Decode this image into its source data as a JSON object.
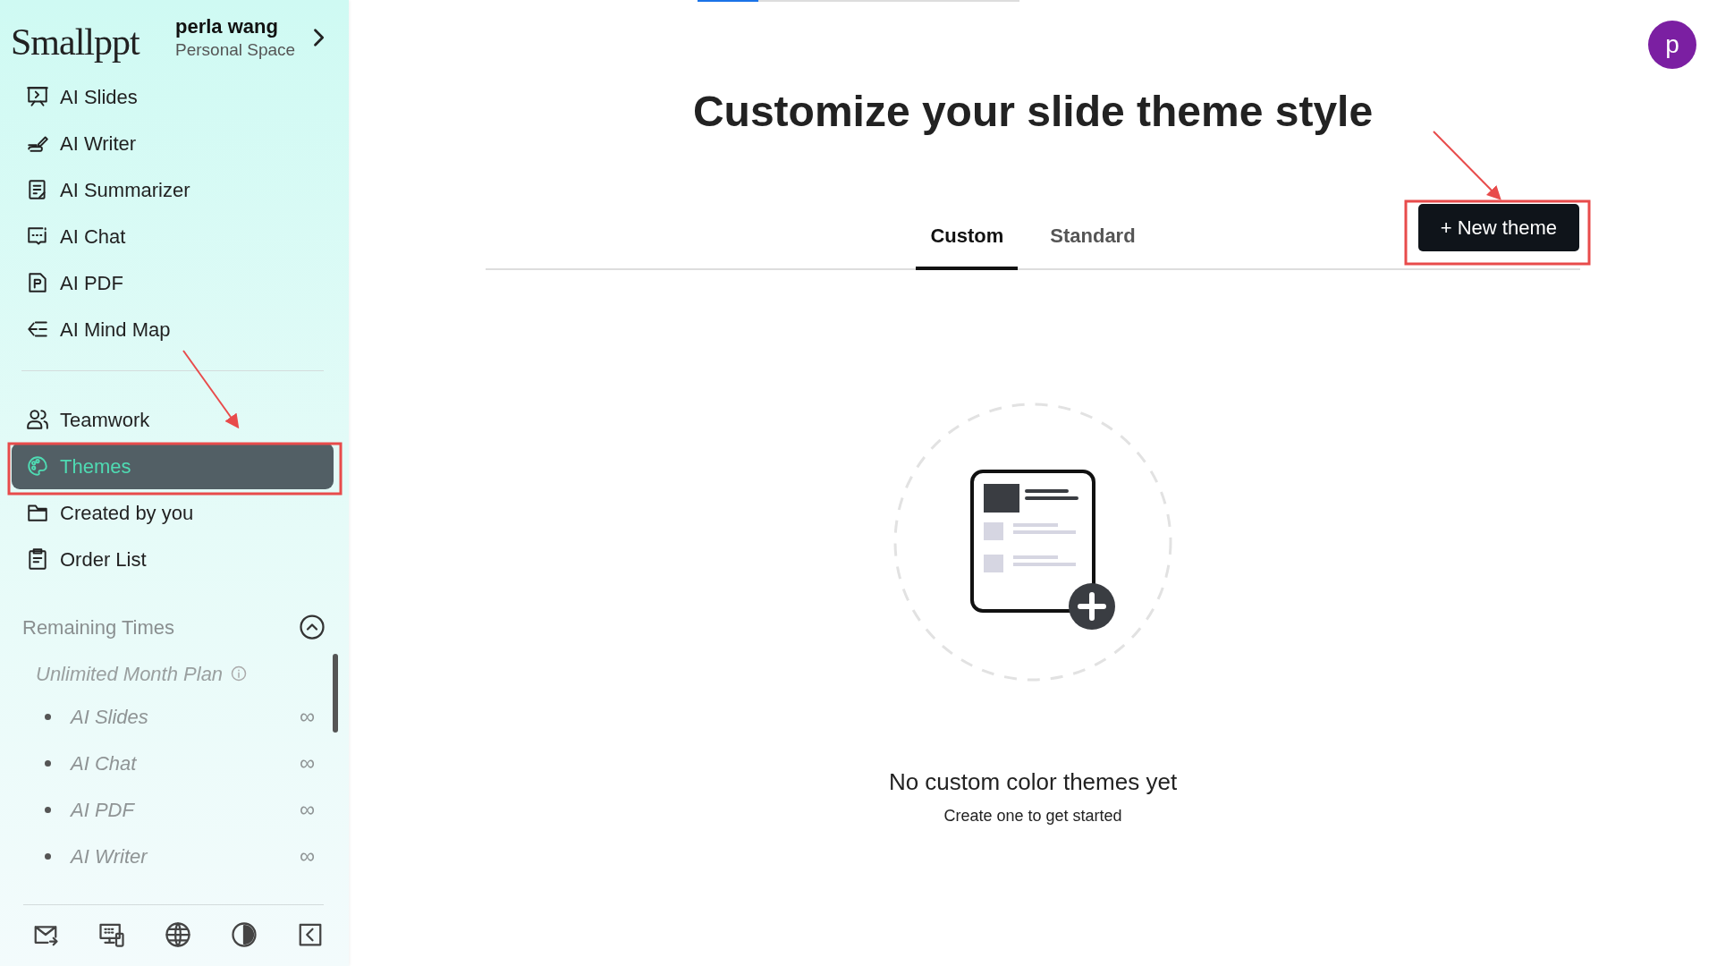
{
  "sidebar": {
    "logo": "Smallppt",
    "user": {
      "name": "perla wang",
      "space": "Personal Space"
    },
    "nav": [
      {
        "label": "AI Slides",
        "selected": false
      },
      {
        "label": "AI Writer",
        "selected": false
      },
      {
        "label": "AI Summarizer",
        "selected": false
      },
      {
        "label": "AI Chat",
        "selected": false
      },
      {
        "label": "AI PDF",
        "selected": false
      },
      {
        "label": "AI Mind Map",
        "selected": false
      }
    ],
    "nav_secondary": [
      {
        "label": "Teamwork",
        "selected": false
      },
      {
        "label": "Themes",
        "selected": true
      },
      {
        "label": "Created by you",
        "selected": false
      },
      {
        "label": "Order List",
        "selected": false
      }
    ],
    "remaining": {
      "title": "Remaining Times",
      "expanded": true,
      "plan": "Unlimited Month Plan",
      "items": [
        {
          "label": "AI Slides",
          "value": "∞"
        },
        {
          "label": "AI Chat",
          "value": "∞"
        },
        {
          "label": "AI PDF",
          "value": "∞"
        },
        {
          "label": "AI Writer",
          "value": "∞"
        }
      ]
    }
  },
  "main": {
    "progress": {
      "level": 0.19
    },
    "avatar": "p",
    "title": "Customize your slide theme style",
    "tabs": [
      {
        "label": "Custom",
        "selected": true
      },
      {
        "label": "Standard",
        "selected": false
      }
    ],
    "new_button": "+ New theme",
    "empty": {
      "title": "No custom color themes yet",
      "subtitle": "Create one to get started"
    }
  }
}
